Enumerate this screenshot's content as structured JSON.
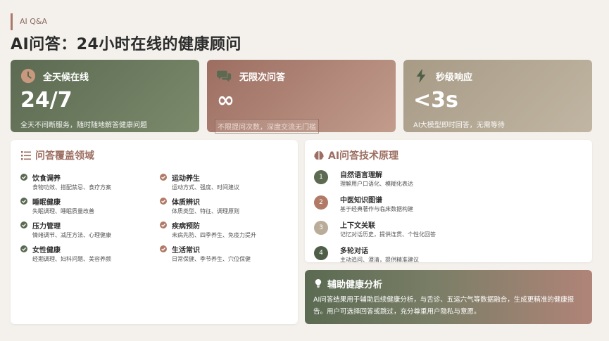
{
  "section_tag": "AI Q&A",
  "page_title": "AI问答：24小时在线的健康顾问",
  "stats": [
    {
      "label": "全天候在线",
      "value": "24/7",
      "desc": "全天不间断服务，随时随地解答健康问题",
      "icon": "clock-icon"
    },
    {
      "label": "无限次问答",
      "value": "∞",
      "desc": "不限提问次数，深度交流无门槛",
      "icon": "chat-bubbles-icon"
    },
    {
      "label": "秒级响应",
      "value": "<3s",
      "desc": "AI大模型即时回答，无需等待",
      "icon": "lightning-icon"
    }
  ],
  "coverage": {
    "title": "问答覆盖领域",
    "icon": "list-icon",
    "items": [
      {
        "title": "饮食调养",
        "desc": "食物功效、搭配禁忌、食疗方案"
      },
      {
        "title": "睡眠健康",
        "desc": "失眠调理、睡眠质量改善"
      },
      {
        "title": "压力管理",
        "desc": "情绪调节、减压方法、心理健康"
      },
      {
        "title": "女性健康",
        "desc": "经期调理、妇科问题、美容养颜"
      },
      {
        "title": "运动养生",
        "desc": "运动方式、强度、时间建议"
      },
      {
        "title": "体质辨识",
        "desc": "体质类型、特征、调理原则"
      },
      {
        "title": "疾病预防",
        "desc": "未病先防、四季养生、免疫力提升"
      },
      {
        "title": "生活常识",
        "desc": "日常保健、季节养生、穴位保健"
      }
    ]
  },
  "tech": {
    "title": "AI问答技术原理",
    "icon": "brain-icon",
    "items": [
      {
        "num": "1",
        "title": "自然语言理解",
        "desc": "理解用户口语化、模糊化表达"
      },
      {
        "num": "2",
        "title": "中医知识图谱",
        "desc": "基于经典著作与临床数据构建"
      },
      {
        "num": "3",
        "title": "上下文关联",
        "desc": "记忆对话历史，提供连贯、个性化回答"
      },
      {
        "num": "4",
        "title": "多轮对话",
        "desc": "主动追问、澄清，提供精准建议"
      }
    ]
  },
  "assist": {
    "title": "辅助健康分析",
    "icon": "lightbulb-icon",
    "text": "AI问答结果用于辅助后续健康分析，与舌诊、五运六气等数据融合，生成更精准的健康报告。用户可选择回答或跳过，充分尊重用户隐私与意愿。"
  },
  "colors": {
    "green": "#5c6a52",
    "rose": "#9c6e61",
    "sand": "#a79b86",
    "check_green": "#5c6a52",
    "check_rose": "#b07a66"
  }
}
